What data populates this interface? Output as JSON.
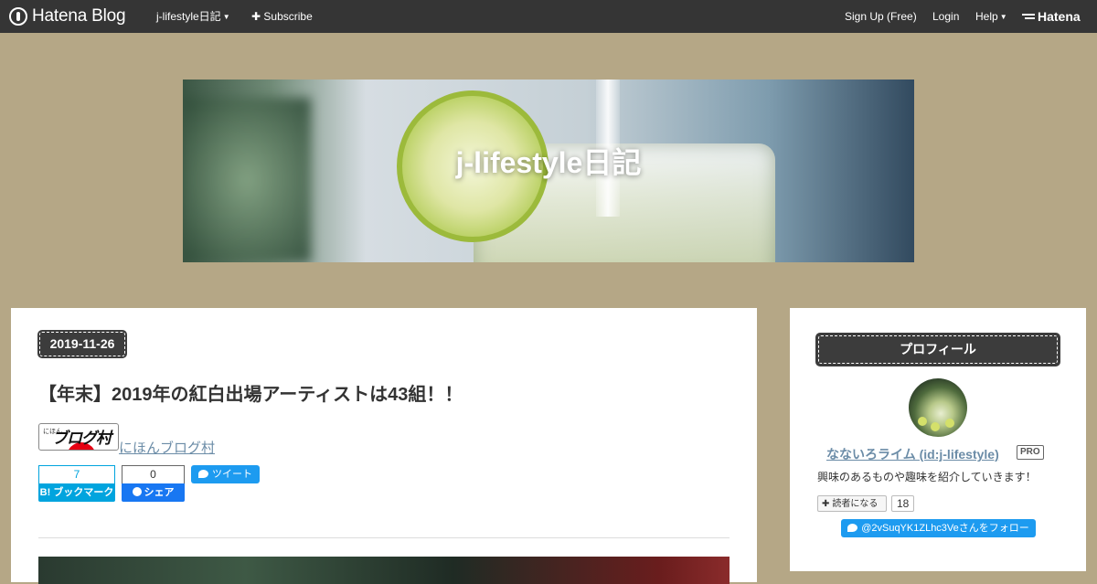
{
  "topbar": {
    "logo_text": "Hatena Blog",
    "blog_menu": "j-lifestyle日記",
    "subscribe": "Subscribe",
    "signup": "Sign Up (Free)",
    "login": "Login",
    "help": "Help",
    "brand": "Hatena"
  },
  "header": {
    "blog_title": "j-lifestyle日記"
  },
  "entry": {
    "date": "2019-11-26",
    "title": "【年末】2019年の紅白出場アーティストは43組！！",
    "blogmura_banner_text": "ブログ村",
    "blogmura_banner_small": "にほん",
    "blogmura_link": "にほんブログ村",
    "hatena_bookmark_count": "7",
    "hatena_bookmark_label": "B! ブックマーク",
    "facebook_count": "0",
    "facebook_label": "シェア",
    "tweet_label": "ツイート"
  },
  "sidebar": {
    "profile_heading": "プロフィール",
    "profile_name": "なないろライム (id:j-lifestyle)",
    "pro_badge": "PRO",
    "description": "興味のあるものや趣味を紹介していきます！",
    "follow_label": "読者になる",
    "follow_count": "18",
    "twitter_follow": "@2vSuqYK1ZLhc3Veさんをフォロー"
  },
  "colors": {
    "background": "#b5a786",
    "topbar": "#353535",
    "heading_badge": "#3c3c3c",
    "link": "#6b8ca7",
    "hatena_blue": "#00a4de",
    "twitter_blue": "#1d9bf0",
    "facebook_blue": "#1877f2"
  }
}
